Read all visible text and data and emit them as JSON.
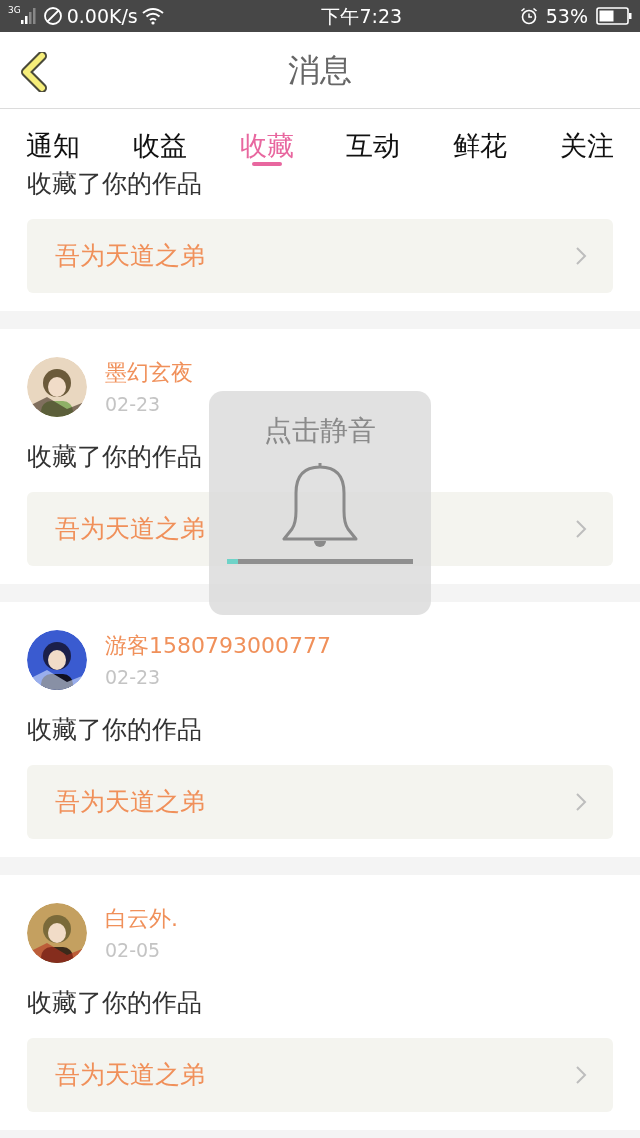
{
  "status_bar": {
    "network": "3G",
    "speed": "0.00K/s",
    "time": "下午7:23",
    "battery": "53%"
  },
  "header": {
    "title": "消息"
  },
  "tabs": [
    {
      "label": "通知",
      "selected": false
    },
    {
      "label": "收益",
      "selected": false
    },
    {
      "label": "收藏",
      "selected": true
    },
    {
      "label": "互动",
      "selected": false
    },
    {
      "label": "鲜花",
      "selected": false
    },
    {
      "label": "关注",
      "selected": false
    }
  ],
  "items": [
    {
      "kind": "partial",
      "action": "收藏了你的作品",
      "book": "吾为天道之弟"
    },
    {
      "kind": "full",
      "user": "墨幻玄夜",
      "date": "02-23",
      "action": "收藏了你的作品",
      "book": "吾为天道之弟"
    },
    {
      "kind": "full",
      "user": "游客1580793000777",
      "date": "02-23",
      "action": "收藏了你的作品",
      "book": "吾为天道之弟"
    },
    {
      "kind": "full",
      "user": "白云外.",
      "date": "02-05",
      "action": "收藏了你的作品",
      "book": "吾为天道之弟"
    }
  ],
  "volume_popup": {
    "label": "点击静音",
    "level": 0.06
  }
}
